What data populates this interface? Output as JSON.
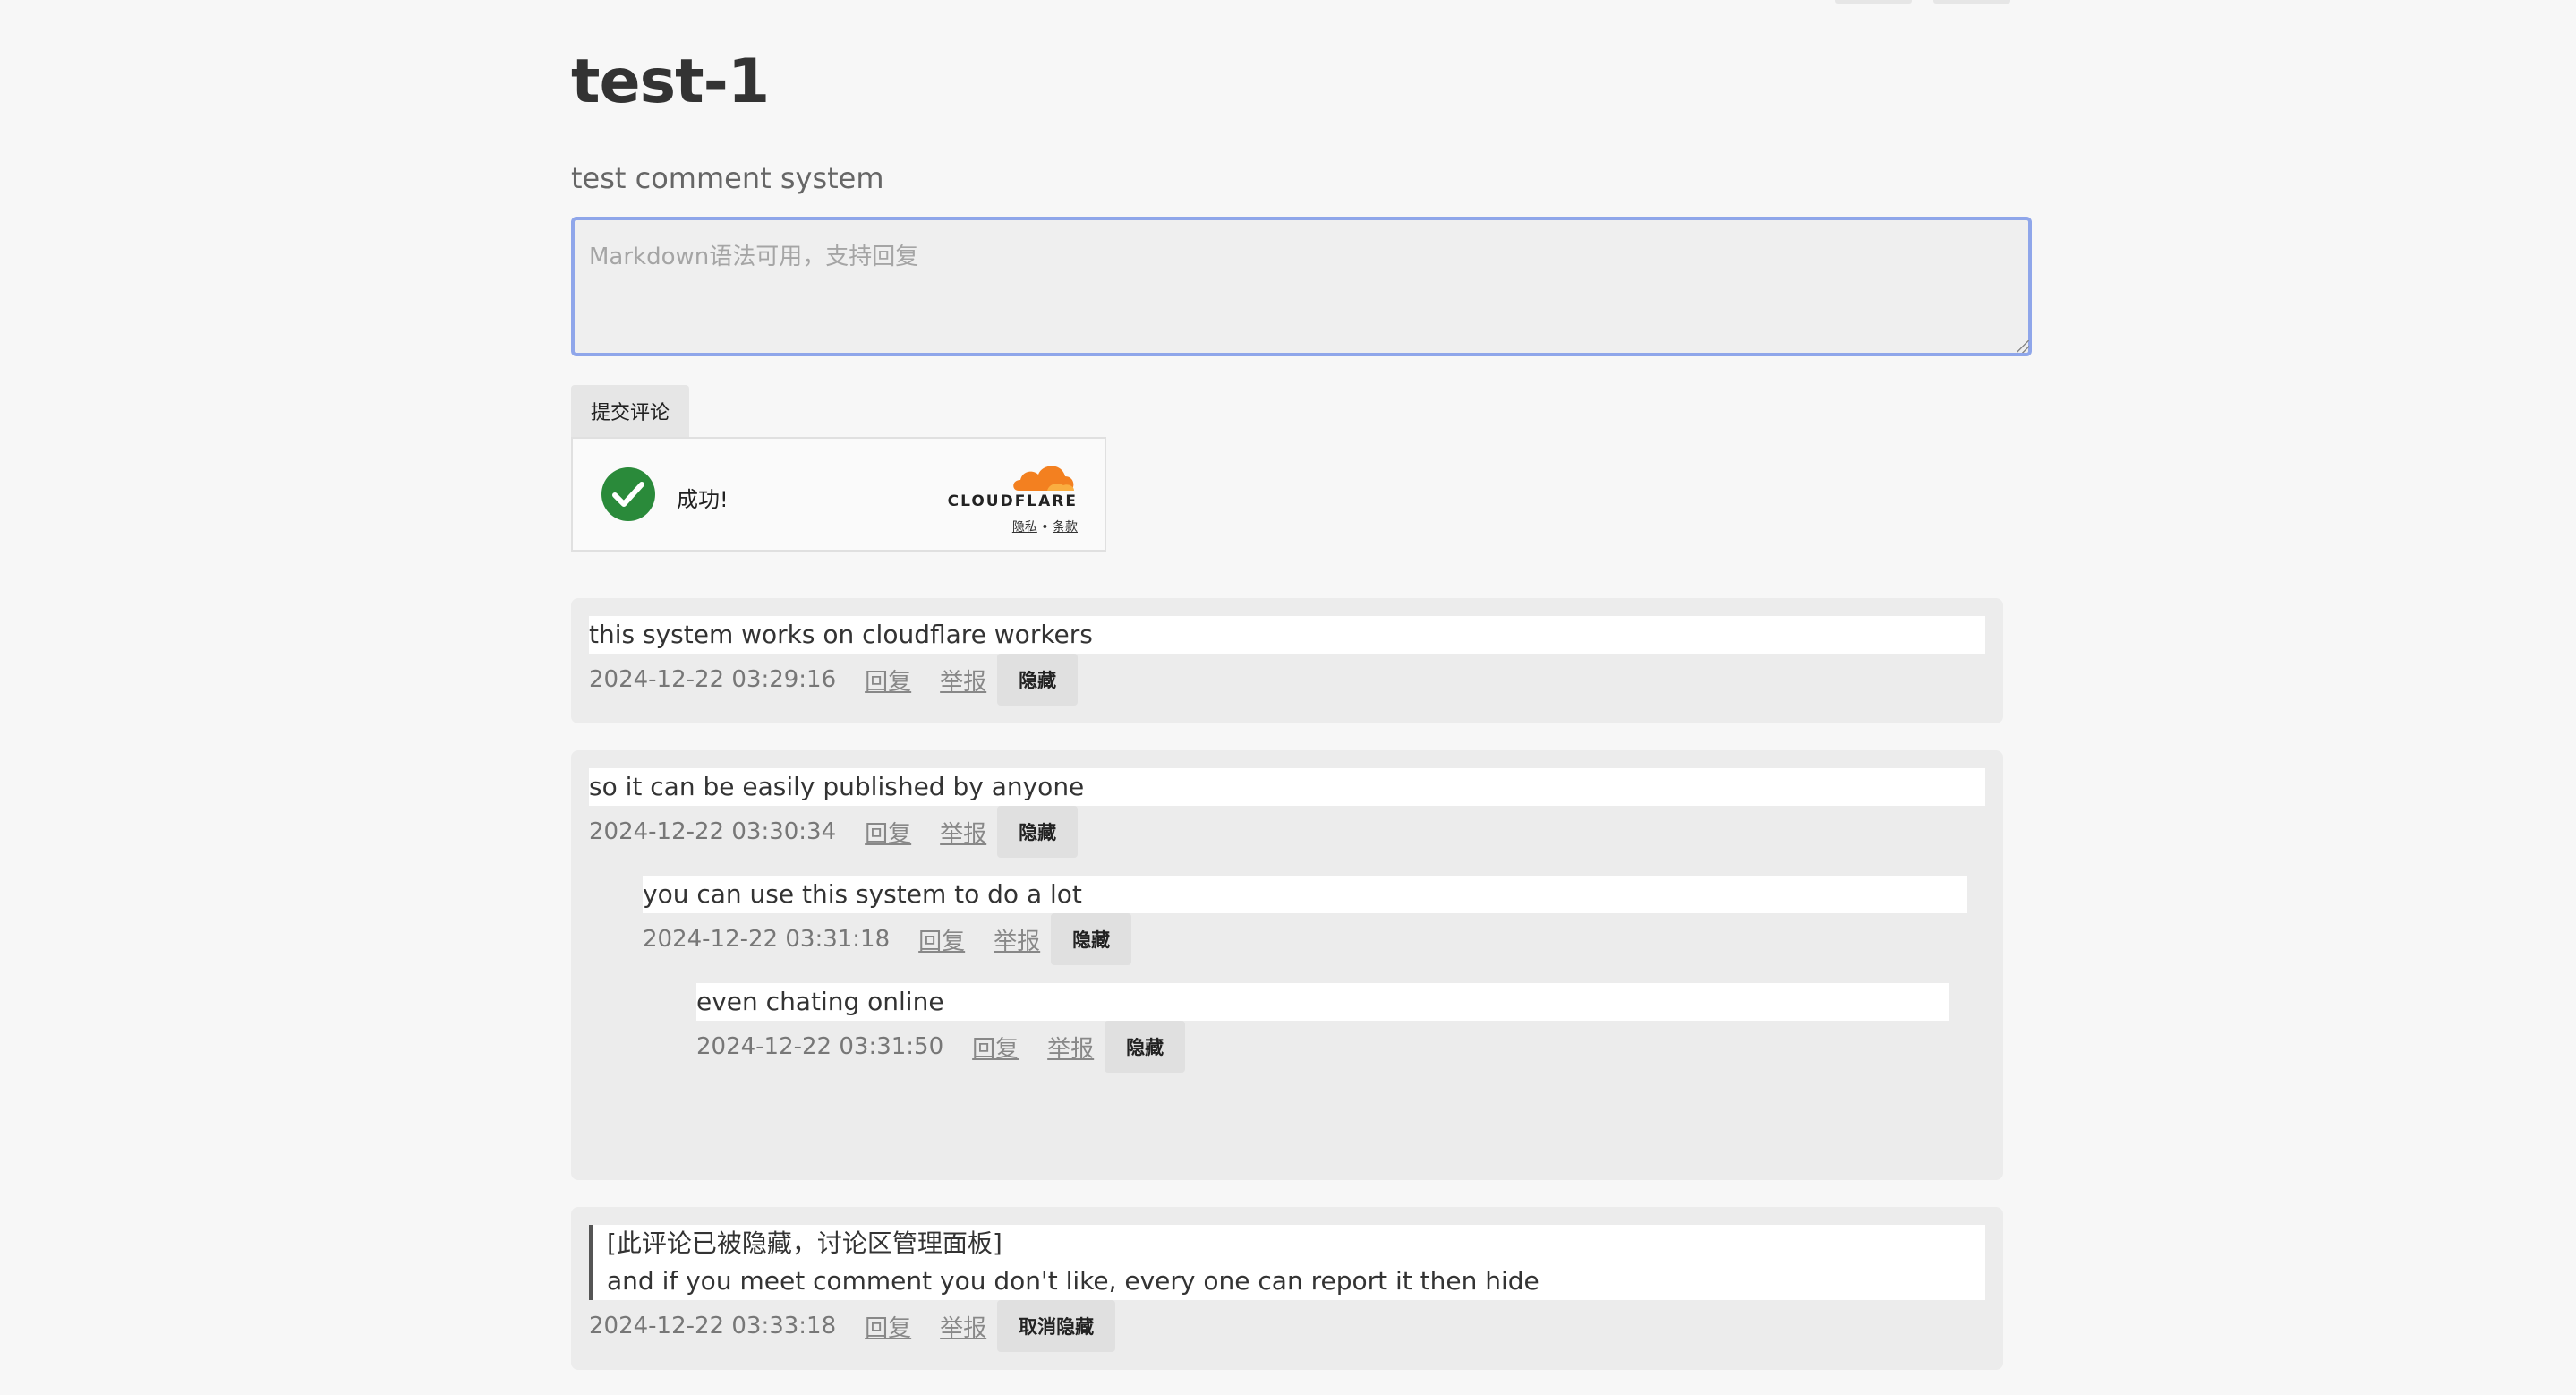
{
  "page": {
    "title": "test-1",
    "subtitle": "test comment system"
  },
  "editor": {
    "placeholder": "Markdown语法可用，支持回复",
    "value": ""
  },
  "submit": {
    "label": "提交评论"
  },
  "turnstile": {
    "status": "成功!",
    "brand": "CLOUDFLARE",
    "privacy": "隐私",
    "separator": "•",
    "terms": "条款",
    "check_color": "#2a8a3a",
    "brand_color": "#f38020"
  },
  "comments": [
    {
      "text": "this system works on cloudflare workers",
      "time": "2024-12-22 03:29:16",
      "reply": "回复",
      "report": "举报",
      "action": "隐藏"
    },
    {
      "text": "so it can be easily published by anyone",
      "time": "2024-12-22 03:30:34",
      "reply": "回复",
      "report": "举报",
      "action": "隐藏",
      "replies": [
        {
          "text": "you can use this system to do a lot",
          "time": "2024-12-22 03:31:18",
          "reply": "回复",
          "report": "举报",
          "action": "隐藏",
          "replies": [
            {
              "text": "even chating online",
              "time": "2024-12-22 03:31:50",
              "reply": "回复",
              "report": "举报",
              "action": "隐藏"
            }
          ]
        }
      ]
    },
    {
      "hidden_notice": "[此评论已被隐藏，讨论区管理面板]",
      "text": "and if you meet comment you don't like, every one can report it then hide",
      "time": "2024-12-22 03:33:18",
      "reply": "回复",
      "report": "举报",
      "action": "取消隐藏"
    }
  ]
}
